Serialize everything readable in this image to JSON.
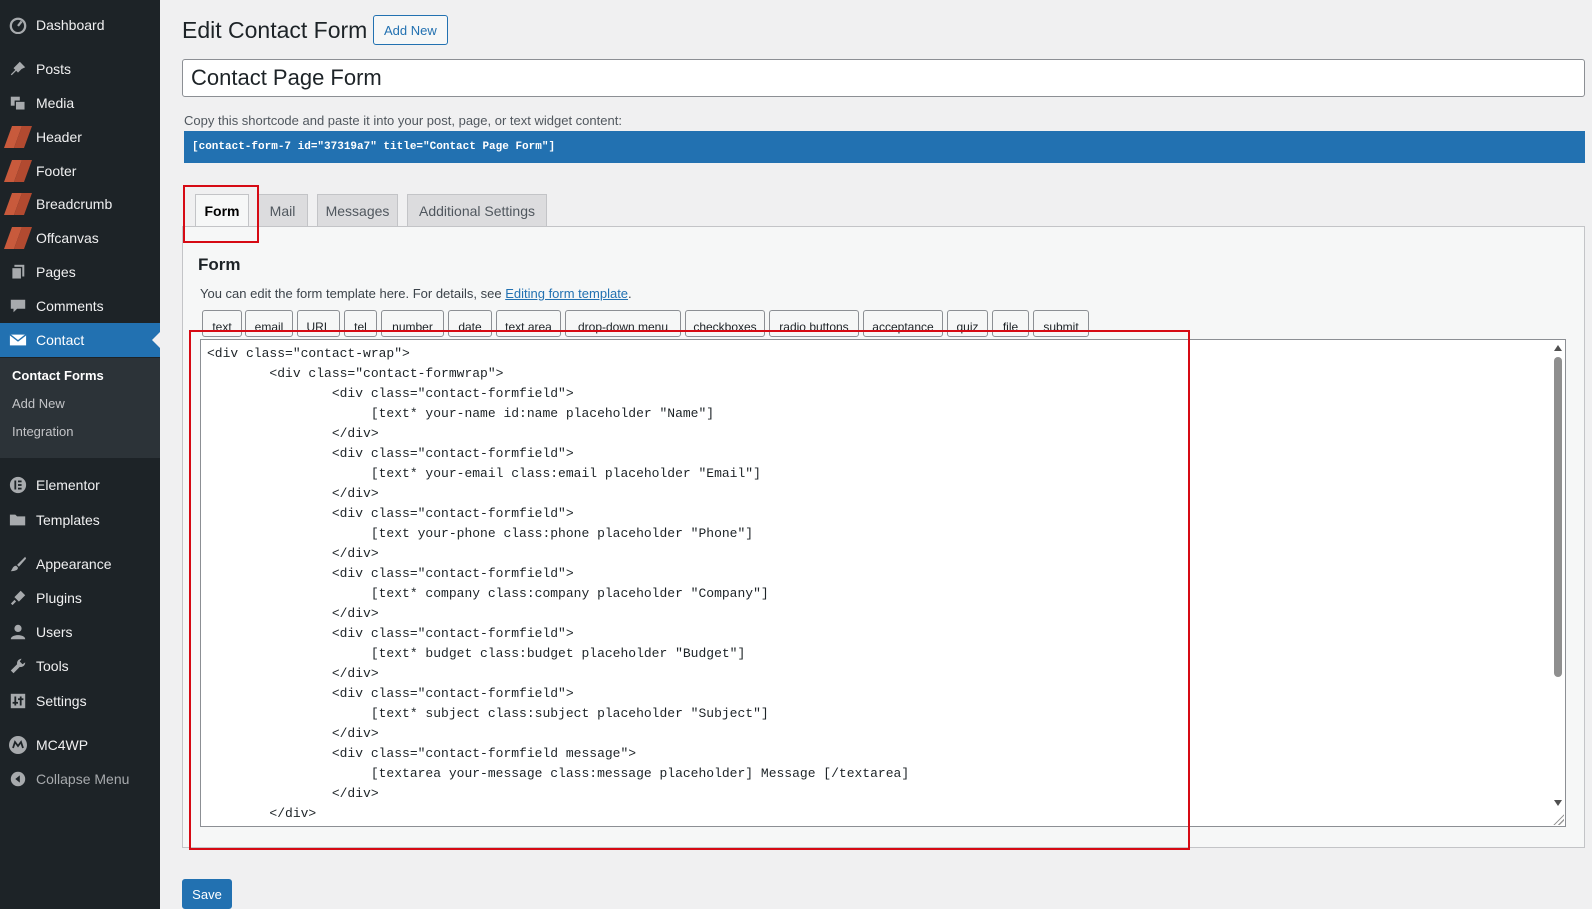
{
  "sidebar": {
    "items": [
      {
        "label": "Dashboard",
        "icon": "dashboard-icon"
      },
      {
        "label": "Posts",
        "icon": "pin-icon"
      },
      {
        "label": "Media",
        "icon": "media-icon"
      },
      {
        "label": "Header",
        "icon": "elementor-template-icon"
      },
      {
        "label": "Footer",
        "icon": "elementor-template-icon"
      },
      {
        "label": "Breadcrumb",
        "icon": "elementor-template-icon"
      },
      {
        "label": "Offcanvas",
        "icon": "elementor-template-icon"
      },
      {
        "label": "Pages",
        "icon": "pages-icon"
      },
      {
        "label": "Comments",
        "icon": "comments-icon"
      },
      {
        "label": "Contact",
        "icon": "mail-icon"
      },
      {
        "label": "Elementor",
        "icon": "elementor-icon"
      },
      {
        "label": "Templates",
        "icon": "folder-icon"
      },
      {
        "label": "Appearance",
        "icon": "brush-icon"
      },
      {
        "label": "Plugins",
        "icon": "plugin-icon"
      },
      {
        "label": "Users",
        "icon": "user-icon"
      },
      {
        "label": "Tools",
        "icon": "wrench-icon"
      },
      {
        "label": "Settings",
        "icon": "settings-icon"
      },
      {
        "label": "MC4WP",
        "icon": "mc4wp-icon"
      },
      {
        "label": "Collapse Menu",
        "icon": "collapse-icon"
      }
    ],
    "submenu": [
      {
        "label": "Contact Forms"
      },
      {
        "label": "Add New"
      },
      {
        "label": "Integration"
      }
    ]
  },
  "header": {
    "title": "Edit Contact Form",
    "add_new": "Add New"
  },
  "form_title": "Contact Page Form",
  "shortcode": {
    "hint": "Copy this shortcode and paste it into your post, page, or text widget content:",
    "code": "[contact-form-7 id=\"37319a7\" title=\"Contact Page Form\"]"
  },
  "tabs": [
    {
      "label": "Form"
    },
    {
      "label": "Mail"
    },
    {
      "label": "Messages"
    },
    {
      "label": "Additional Settings"
    }
  ],
  "panel": {
    "title": "Form",
    "desc_prefix": "You can edit the form template here. For details, see ",
    "desc_link": "Editing form template",
    "desc_suffix": "."
  },
  "tag_buttons": [
    "text",
    "email",
    "URL",
    "tel",
    "number",
    "date",
    "text area",
    "drop-down menu",
    "checkboxes",
    "radio buttons",
    "acceptance",
    "quiz",
    "file",
    "submit"
  ],
  "code_lines": [
    "<div class=\"contact-wrap\">",
    "        <div class=\"contact-formwrap\">",
    "                <div class=\"contact-formfield\">",
    "                     [text* your-name id:name placeholder \"Name\"]",
    "                </div>",
    "                <div class=\"contact-formfield\">",
    "                     [text* your-email class:email placeholder \"Email\"]",
    "                </div>",
    "                <div class=\"contact-formfield\">",
    "                     [text your-phone class:phone placeholder \"Phone\"]",
    "                </div>",
    "                <div class=\"contact-formfield\">",
    "                     [text* company class:company placeholder \"Company\"]",
    "                </div>",
    "                <div class=\"contact-formfield\">",
    "                     [text* budget class:budget placeholder \"Budget\"]",
    "                </div>",
    "                <div class=\"contact-formfield\">",
    "                     [text* subject class:subject placeholder \"Subject\"]",
    "                </div>",
    "                <div class=\"contact-formfield message\">",
    "                     [textarea your-message class:message placeholder] Message [/textarea]",
    "                </div>",
    "        </div>"
  ],
  "save_label": "Save",
  "colors": {
    "sidebar_bg": "#1d2327",
    "accent": "#2271b1",
    "highlight": "#d60a14"
  }
}
